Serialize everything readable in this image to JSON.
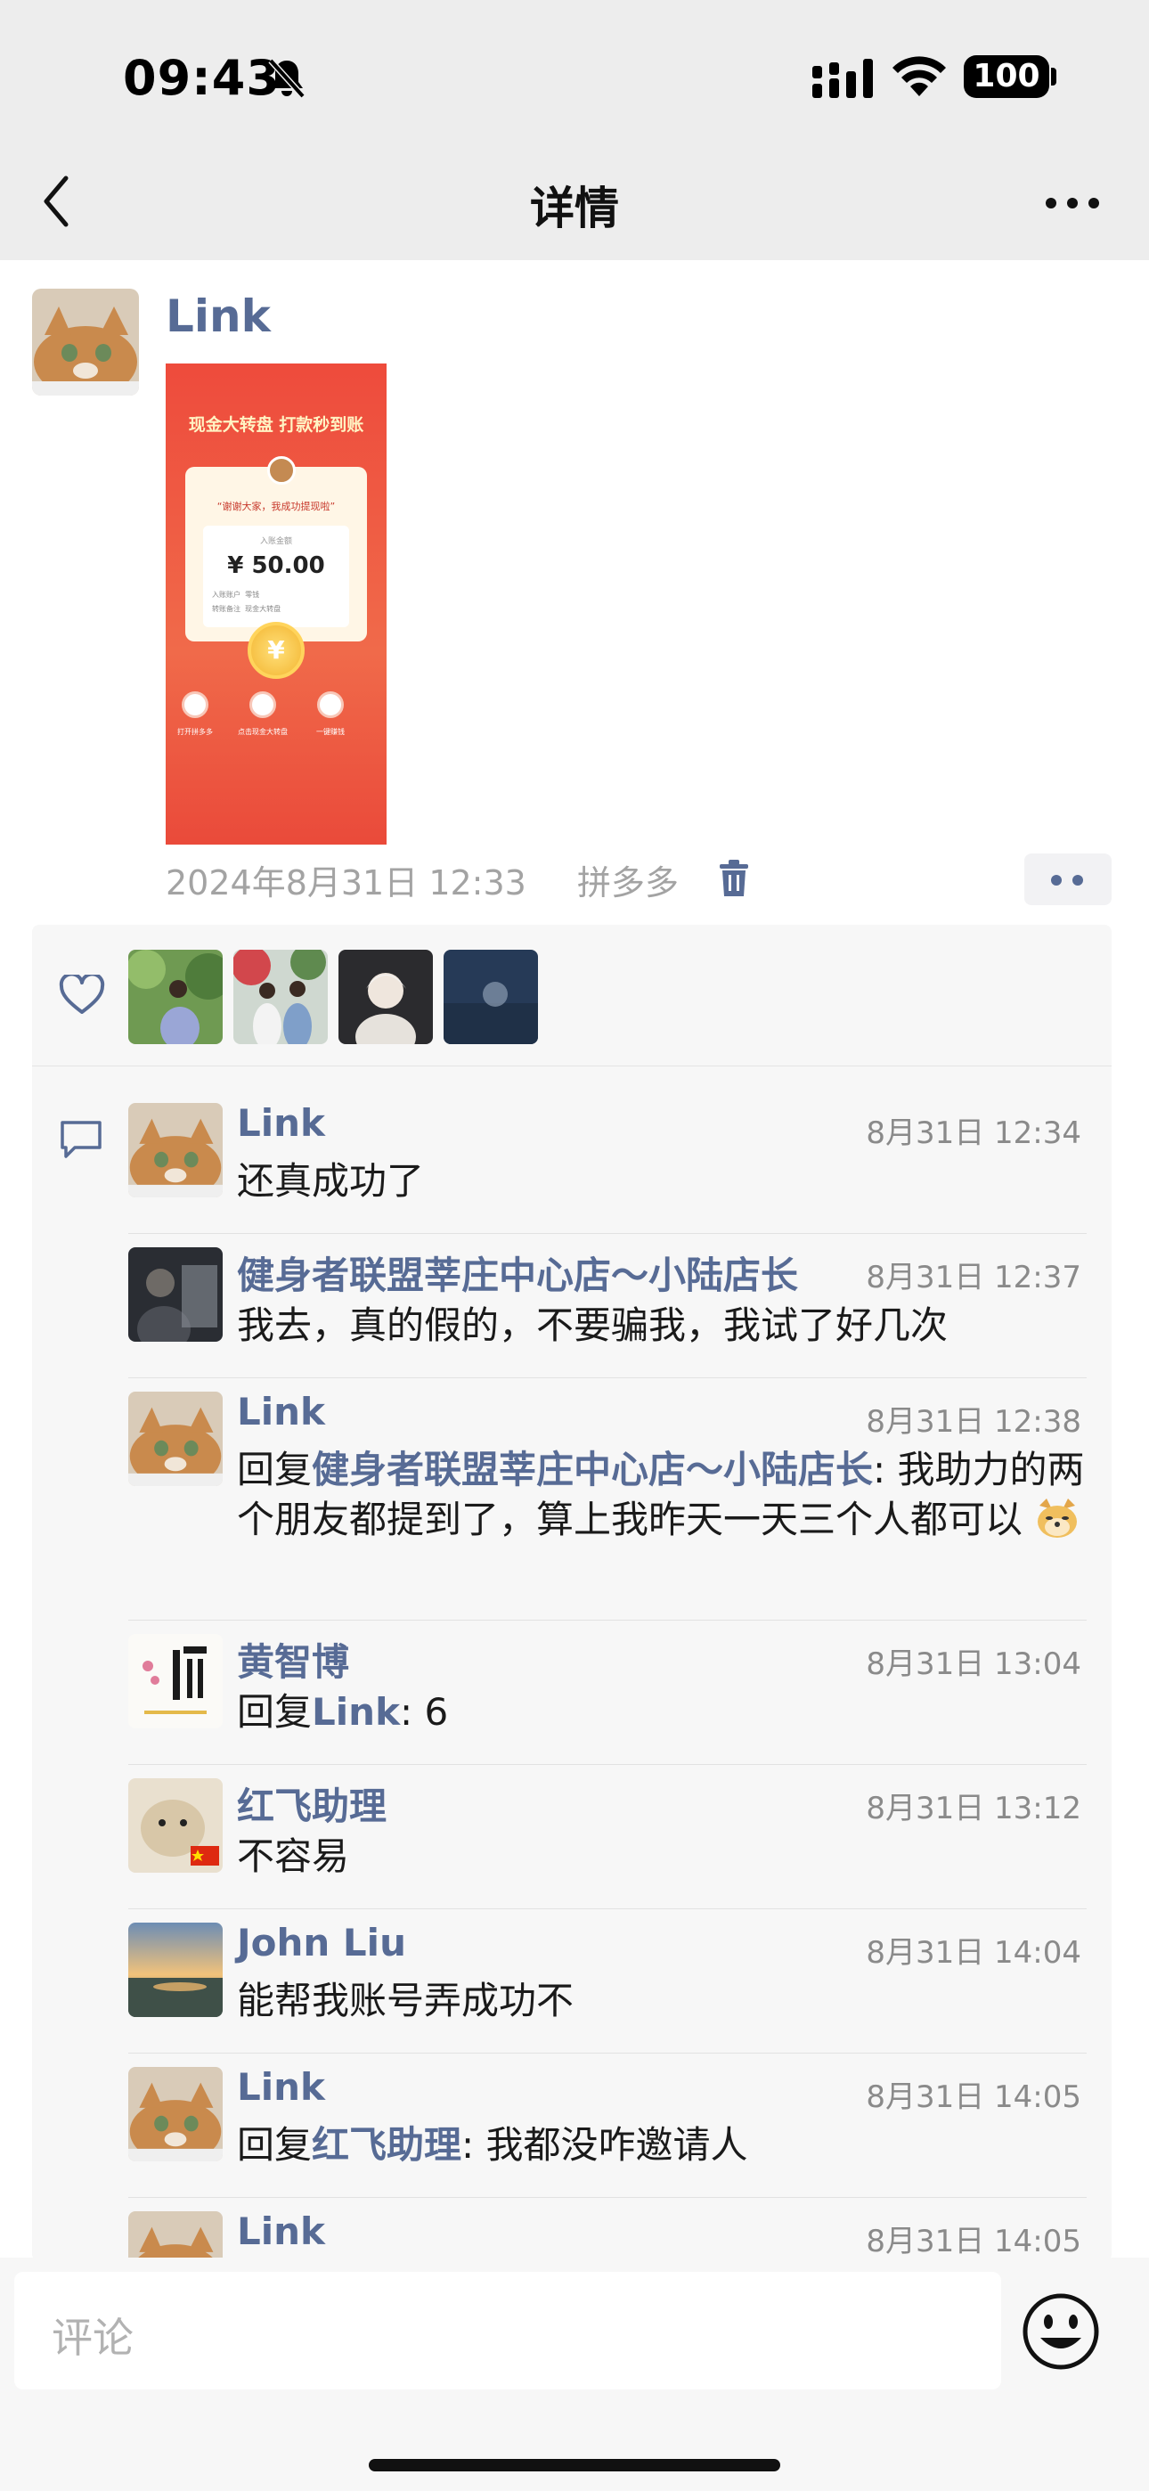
{
  "status_bar": {
    "time": "09:43",
    "battery": "100"
  },
  "nav": {
    "title": "详情"
  },
  "post": {
    "author": "Link",
    "image": {
      "headline": "现金大转盘 打款秒到账",
      "quote": "“谢谢大家，我成功提现啦”",
      "amount_label": "入账金额",
      "amount": "¥ 50.00",
      "row1_label": "入账账户",
      "row1_value": "零钱",
      "row2_label": "转账备注",
      "row2_value": "现金大转盘",
      "coin": "¥",
      "icon_labels": [
        "打开拼多多",
        "点击现金大转盘",
        "一键赚钱"
      ]
    },
    "timestamp": "2024年8月31日 12:33",
    "source_app": "拼多多"
  },
  "likes": {
    "count_shown": 4
  },
  "comments": [
    {
      "name": "Link",
      "time": "8月31日 12:34",
      "prefix": "",
      "ref": "",
      "text": "还真成功了"
    },
    {
      "name": "健身者联盟莘庄中心店～小陆店长",
      "time": "8月31日 12:37",
      "prefix": "",
      "ref": "",
      "text": "我去，真的假的，不要骗我，我试了好几次"
    },
    {
      "name": "Link",
      "time": "8月31日 12:38",
      "prefix": "回复",
      "ref": "健身者联盟莘庄中心店～小陆店长",
      "text": ": 我助力的两个朋友都提到了，算上我昨天一天三个人都可以"
    },
    {
      "name": "黄智博",
      "time": "8月31日 13:04",
      "prefix": "回复",
      "ref": "Link",
      "text": ": 6"
    },
    {
      "name": "红飞助理",
      "time": "8月31日 13:12",
      "prefix": "",
      "ref": "",
      "text": "不容易"
    },
    {
      "name": "John Liu",
      "time": "8月31日 14:04",
      "prefix": "",
      "ref": "",
      "text": "能帮我账号弄成功不"
    },
    {
      "name": "Link",
      "time": "8月31日 14:05",
      "prefix": "回复",
      "ref": "红飞助理",
      "text": ": 我都没咋邀请人"
    },
    {
      "name": "Link",
      "time": "8月31日 14:05",
      "prefix": "",
      "ref": "",
      "text": ""
    }
  ],
  "input": {
    "placeholder": "评论"
  },
  "colors": {
    "link": "#576b95",
    "nav_bg": "#ededed",
    "panel_bg": "#f7f7f7",
    "red_packet": "#ee4b3c"
  },
  "icons": [
    "bell-slash-icon",
    "signal-icon",
    "wifi-icon",
    "back-icon",
    "more-icon",
    "trash-icon",
    "heart-icon",
    "comment-icon",
    "emoji-icon"
  ]
}
